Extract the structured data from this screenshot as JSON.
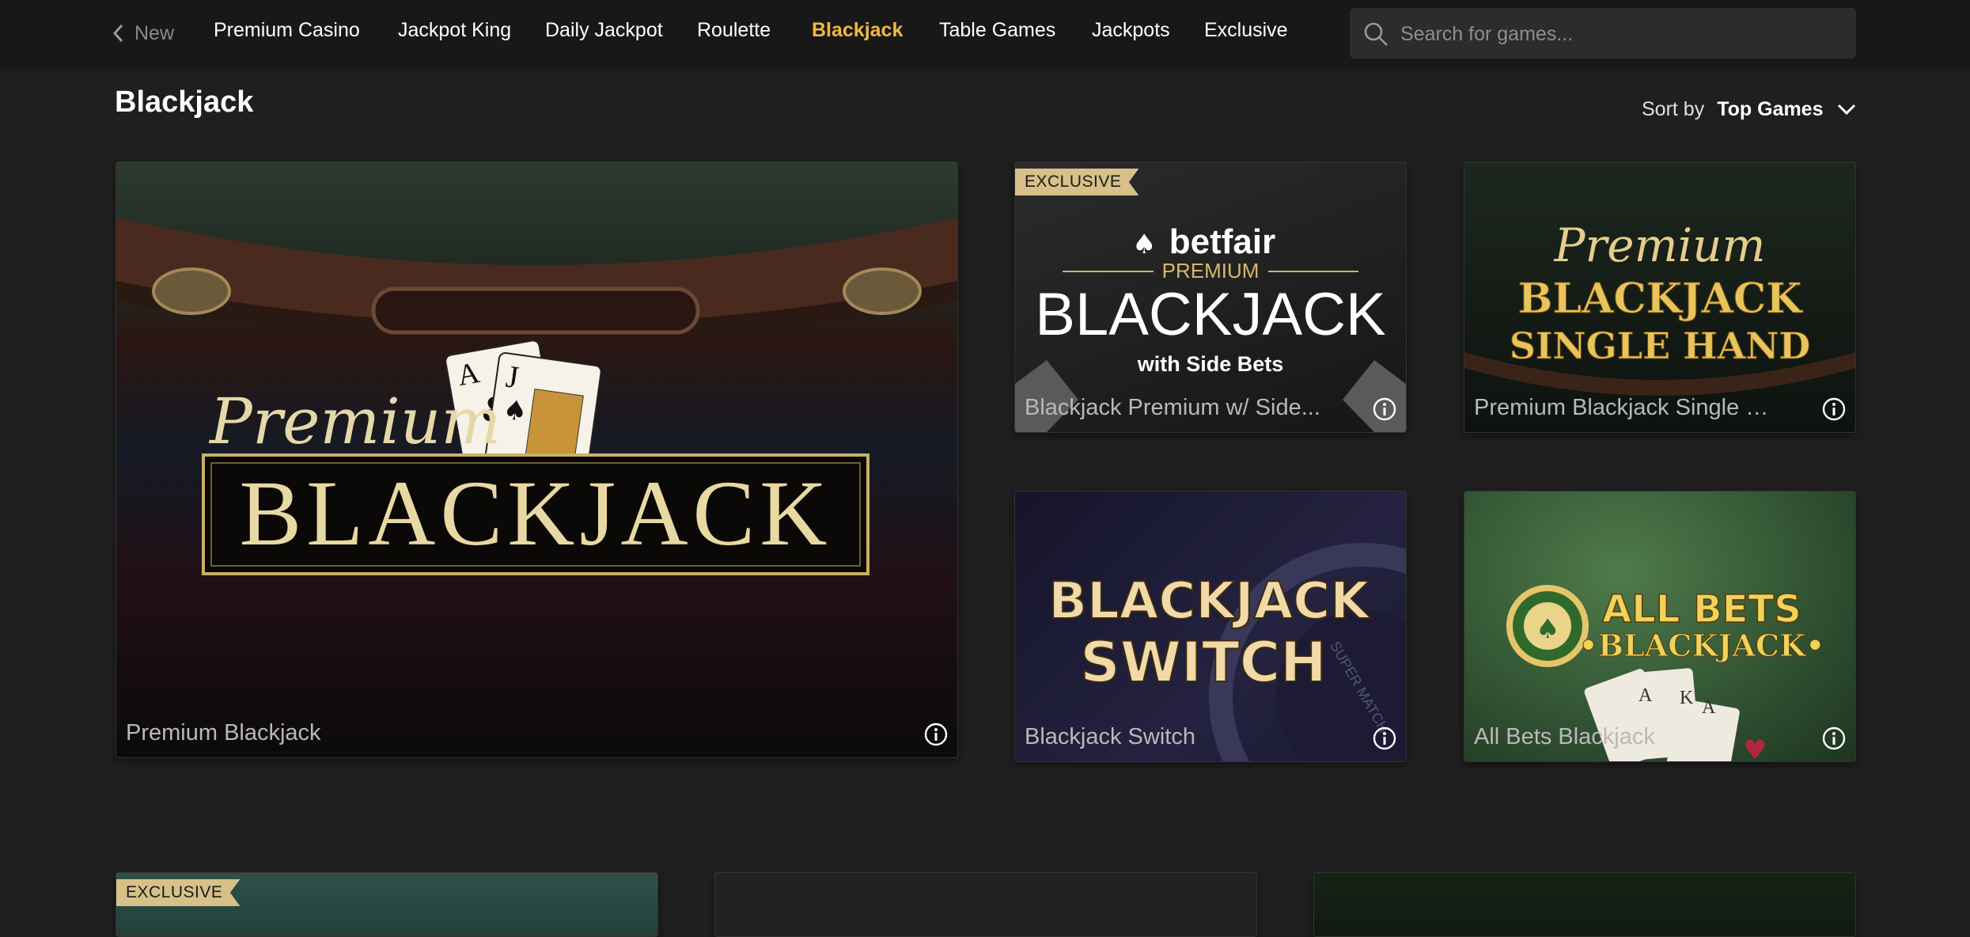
{
  "nav": {
    "back_label": "New",
    "items": [
      {
        "label": "Premium Casino",
        "active": false
      },
      {
        "label": "Jackpot King",
        "active": false
      },
      {
        "label": "Daily Jackpot",
        "active": false
      },
      {
        "label": "Roulette",
        "active": false
      },
      {
        "label": "Blackjack",
        "active": true
      },
      {
        "label": "Table Games",
        "active": false
      },
      {
        "label": "Jackpots",
        "active": false
      },
      {
        "label": "Exclusive",
        "active": false
      }
    ],
    "search_placeholder": "Search for games..."
  },
  "page": {
    "title": "Blackjack",
    "sort_label": "Sort by",
    "sort_value": "Top Games"
  },
  "tiles": [
    {
      "name": "Premium Blackjack",
      "badge": "",
      "art": {
        "script": "Premium",
        "main": "BLACKJACK",
        "cards": [
          "A",
          "J"
        ]
      }
    },
    {
      "name": "Blackjack Premium w/ Side...",
      "badge": "EXCLUSIVE",
      "art": {
        "brand": "betfair",
        "sub": "PREMIUM",
        "main": "BLACKJACK",
        "tag": "with Side Bets"
      }
    },
    {
      "name": "Premium Blackjack Single H...",
      "badge": "",
      "art": {
        "script": "Premium",
        "main": "BLACKJACK",
        "sub": "SINGLE HAND"
      }
    },
    {
      "name": "Blackjack Switch",
      "badge": "",
      "art": {
        "line1": "BLACKJACK",
        "line2": "SWITCH",
        "chip": "SUPER MATCH"
      }
    },
    {
      "name": "All Bets Blackjack",
      "badge": "",
      "art": {
        "line1": "ALL BETS",
        "line2": "•BLACKJACK•",
        "cards": [
          "A",
          "K",
          "A"
        ]
      }
    }
  ],
  "row2": [
    {
      "badge": "EXCLUSIVE"
    }
  ],
  "colors": {
    "accent": "#f4b740",
    "background": "#1f1f1f",
    "nav_background": "#181818",
    "badge": "#d7c189"
  }
}
